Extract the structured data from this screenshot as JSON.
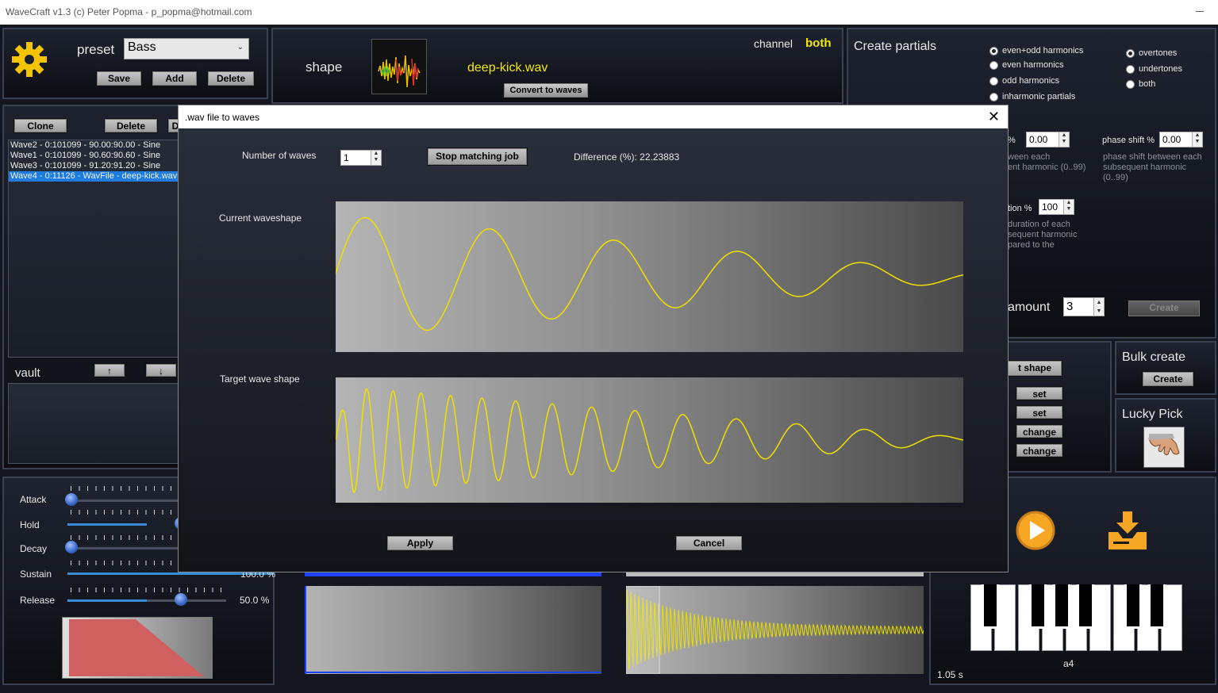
{
  "window": {
    "title": "WaveCraft v1.3   (c) Peter Popma - p_popma@hotmail.com"
  },
  "colors": {
    "accent_yellow": "#ffff00",
    "selection_blue": "#1e7ce0",
    "wave_line": "#f0e000",
    "play_orange": "#f5a623"
  },
  "preset": {
    "label": "preset",
    "selected": "Bass",
    "save_label": "Save",
    "add_label": "Add",
    "delete_label": "Delete"
  },
  "shape": {
    "label": "shape",
    "filename": "deep-kick.wav",
    "convert_label": "Convert to waves",
    "channel_label": "channel",
    "channel_value": "both"
  },
  "partials": {
    "title": "Create partials",
    "harmonics": [
      "even+odd harmonics",
      "even harmonics",
      "odd harmonics",
      "inharmonic partials"
    ],
    "tones": [
      "overtones",
      "undertones",
      "both"
    ],
    "vol_label_frag": "%",
    "vol_value": "0.00",
    "vol_desc_1": "ween each",
    "vol_desc_2": "ent harmonic (0..99)",
    "phase_label": "phase shift %",
    "phase_value": "0.00",
    "phase_desc": "phase shift between each subsequent harmonic (0..99)",
    "duration_label_frag": "tion %",
    "duration_value": "100",
    "duration_desc_1": "duration of each",
    "duration_desc_2": "sequent harmonic",
    "duration_desc_3": "pared to the",
    "amount_label_frag": "amount",
    "amount_value": "3",
    "create_label": "Create"
  },
  "wavelist": {
    "clone_label": "Clone",
    "delete_label": "Delete",
    "d_label_frag": "D",
    "items": [
      "Wave2 - 0:101099 - 90.00:90.00 - Sine",
      "Wave1 - 0:101099 - 90.60:90.60 - Sine",
      "Wave3 - 0:101099 - 91.20:91.20 - Sine",
      "Wave4 - 0:11126 - WavFile - deep-kick.wav"
    ],
    "selected_index": 3,
    "up_arrow": "↑",
    "down_arrow": "↓",
    "vault_label": "vault"
  },
  "shape_tools": {
    "shape_btn_frag": "t shape",
    "set1": "set",
    "set2": "set",
    "change1": "change",
    "change2": "change"
  },
  "bulk": {
    "title": "Bulk create",
    "create_label": "Create"
  },
  "lucky": {
    "title": "Lucky Pick"
  },
  "envelope": {
    "attack_label": "Attack",
    "hold_label": "Hold",
    "decay_label": "Decay",
    "sustain_label": "Sustain",
    "release_label": "Release",
    "sustain_value_frag": "100.0 %",
    "release_value": "50.0 %",
    "attack_level": 0.02,
    "hold_level": 0.7,
    "decay_level": 0.02,
    "release_level": 0.7
  },
  "player": {
    "duration": "1.05 s",
    "note": "a4"
  },
  "dialog": {
    "title": ".wav file to waves",
    "close_glyph": "✕",
    "num_waves_label": "Number of waves",
    "num_waves_value": "1",
    "stop_label": "Stop matching job",
    "difference_text": "Difference (%): 22.23883",
    "current_label": "Current waveshape",
    "target_label": "Target wave shape",
    "apply_label": "Apply",
    "cancel_label": "Cancel"
  }
}
